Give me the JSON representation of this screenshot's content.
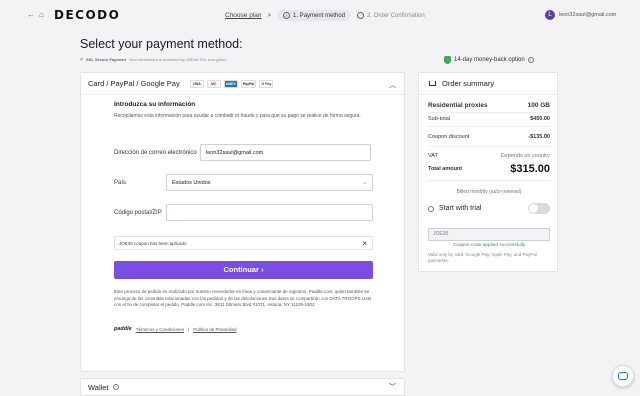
{
  "topbar": {
    "back_icon": "arrow-left-icon",
    "home_icon": "home-icon",
    "logo": "DECODO",
    "steps": {
      "choose_plan": "Choose plan",
      "separator": ">",
      "payment_method": "1. Payment method",
      "order_confirmation": "2. Order Confirmation"
    },
    "user": {
      "initial": "L",
      "email": "leon32saul@gmail.com"
    }
  },
  "page": {
    "title": "Select your payment method:",
    "ssl_label": "SSL Secure Payment",
    "ssl_text": "Your information is protected by 256-bit SSL encryption",
    "money_back": "14-day money-back option"
  },
  "payment": {
    "method_title": "Card / PayPal / Google Pay",
    "brands": [
      "VISA",
      "MC",
      "AMEX",
      "PayPal",
      "G Pay"
    ],
    "intro_title": "Introduzca su información",
    "intro_text": "Recopilamos esta información para ayudar a combatir el fraude y para que su pago se realice de forma segura.",
    "email_label": "Dirección de correo electrónico",
    "email_value": "leon32saul@gmail.com",
    "country_label": "País",
    "country_value": "Estados Unidos",
    "zip_label": "Código postal/ZIP",
    "zip_value": "",
    "coupon_notice": "JOE30 coupon has been aplicado",
    "continue_label": "Continuar",
    "legal_text": "Este proceso de pedido es realizado por nuestro revendedor en línea y comerciante de registros, Paddle.com, quien también se encarga de las consultas relacionadas con los pedidos y de las devoluciones.Sus datos se compartirán con DATA TROOPS UAB con el fin de completar el pedido. Paddle.com Inc. 3811 Ditmars Blvd #1071, Astoria, NY 11105-1803",
    "paddle": "paddle",
    "terms": "Términos y Condiciones",
    "privacy": "Política de Privacidad",
    "wallet_title": "Wallet"
  },
  "summary": {
    "title": "Order summary",
    "product": "Residential proxies",
    "product_amount": "100 GB",
    "subtotal_label": "Sub-total",
    "subtotal_value": "$450.00",
    "coupon_label": "Coupon discount",
    "coupon_value": "-$135.00",
    "vat_label": "VAT",
    "vat_value": "Depends on country",
    "total_label": "Total amount",
    "total_value": "$315.00",
    "billed": "Billed monthly (auto-renewal)",
    "trial_label": "Start with trial",
    "coupon_code": "JOE30",
    "coupon_applied": "Coupon code applied successfully",
    "valid_text": "Valid only by card, Google Pay, Apple Pay, and PayPal payments."
  },
  "colors": {
    "accent": "#7a4ee0",
    "success": "#2e9e4e"
  }
}
